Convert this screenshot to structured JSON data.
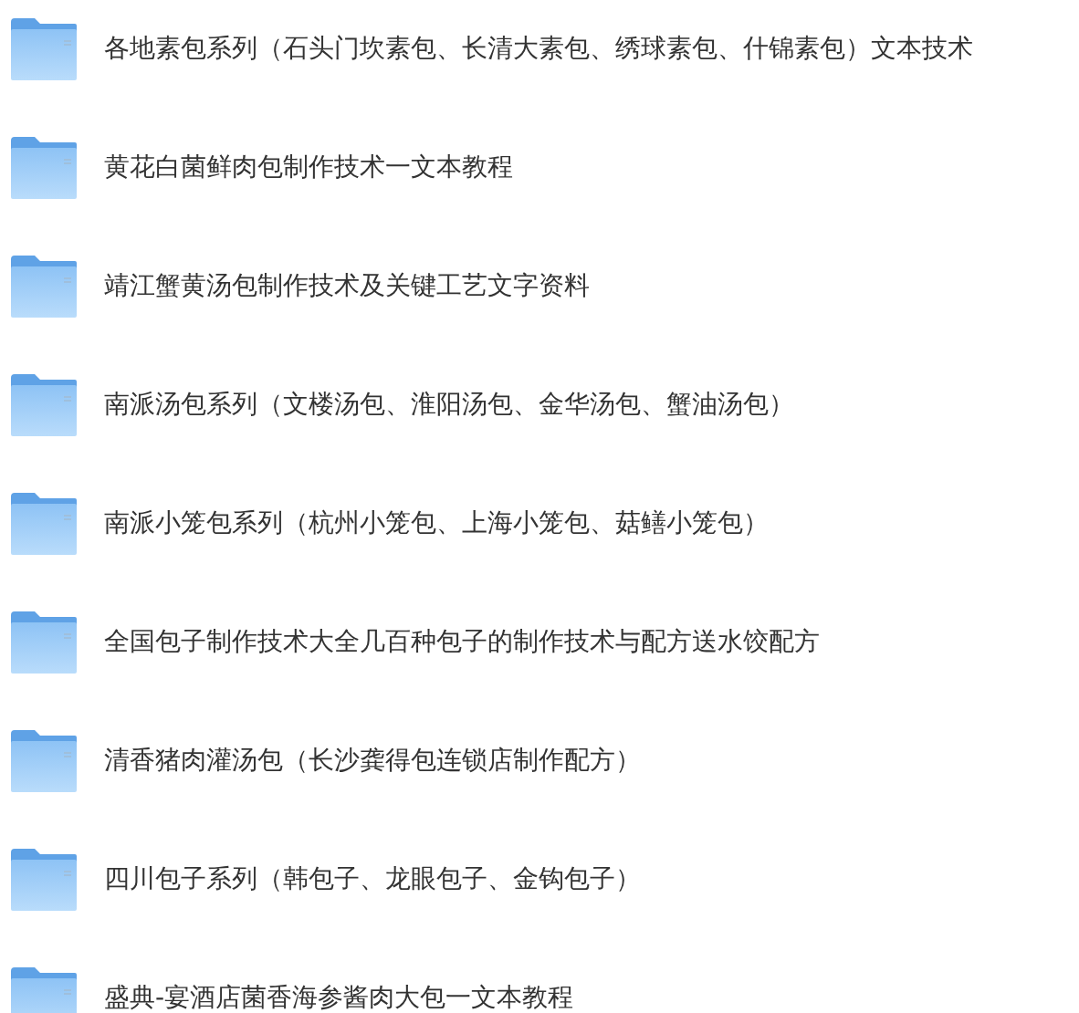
{
  "folders": [
    {
      "name": "各地素包系列（石头门坎素包、长清大素包、绣球素包、什锦素包）文本技术"
    },
    {
      "name": "黄花白菌鲜肉包制作技术一文本教程"
    },
    {
      "name": "靖江蟹黄汤包制作技术及关键工艺文字资料"
    },
    {
      "name": "南派汤包系列（文楼汤包、淮阳汤包、金华汤包、蟹油汤包）"
    },
    {
      "name": "南派小笼包系列（杭州小笼包、上海小笼包、菇鳝小笼包）"
    },
    {
      "name": "全国包子制作技术大全几百种包子的制作技术与配方送水饺配方"
    },
    {
      "name": "清香猪肉灌汤包（长沙龚得包连锁店制作配方）"
    },
    {
      "name": "四川包子系列（韩包子、龙眼包子、金钩包子）"
    },
    {
      "name": "盛典-宴酒店菌香海参酱肉大包一文本教程"
    }
  ]
}
